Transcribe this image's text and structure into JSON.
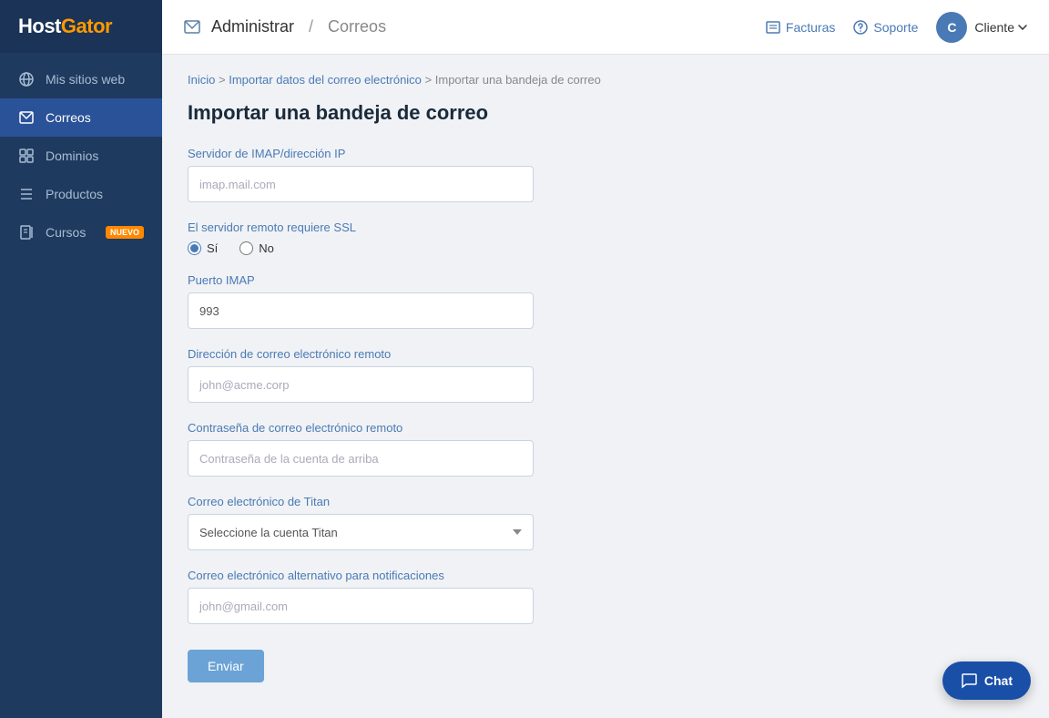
{
  "sidebar": {
    "logo": "HostGator",
    "items": [
      {
        "id": "mis-sitios",
        "label": "Mis sitios web",
        "icon": "globe"
      },
      {
        "id": "correos",
        "label": "Correos",
        "icon": "mail",
        "active": true
      },
      {
        "id": "dominios",
        "label": "Dominios",
        "icon": "grid"
      },
      {
        "id": "productos",
        "label": "Productos",
        "icon": "list"
      },
      {
        "id": "cursos",
        "label": "Cursos",
        "icon": "book",
        "badge": "NUEVO"
      }
    ]
  },
  "header": {
    "icon": "mail",
    "title": "Administrar",
    "separator": "/",
    "subtitle": "Correos",
    "actions": {
      "facturas": "Facturas",
      "soporte": "Soporte",
      "client_initial": "C",
      "client_name": "Cliente"
    }
  },
  "breadcrumb": {
    "items": [
      "Inicio",
      "Importar datos del correo electrónico",
      "Importar una bandeja de correo"
    ],
    "separator": ">"
  },
  "page": {
    "title": "Importar una bandeja de correo",
    "form": {
      "imap_label": "Servidor de IMAP/dirección IP",
      "imap_placeholder": "imap.mail.com",
      "ssl_label": "El servidor remoto requiere SSL",
      "ssl_yes": "Sí",
      "ssl_no": "No",
      "port_label": "Puerto IMAP",
      "port_value": "993",
      "remote_email_label": "Dirección de correo electrónico remoto",
      "remote_email_placeholder": "john@acme.corp",
      "password_label": "Contraseña de correo electrónico remoto",
      "password_placeholder": "Contraseña de la cuenta de arriba",
      "titan_label": "Correo electrónico de Titan",
      "titan_placeholder": "Seleccione la cuenta Titan",
      "alt_email_label": "Correo electrónico alternativo para notificaciones",
      "alt_email_placeholder": "john@gmail.com",
      "submit_label": "Enviar"
    }
  },
  "chat": {
    "label": "Chat"
  }
}
